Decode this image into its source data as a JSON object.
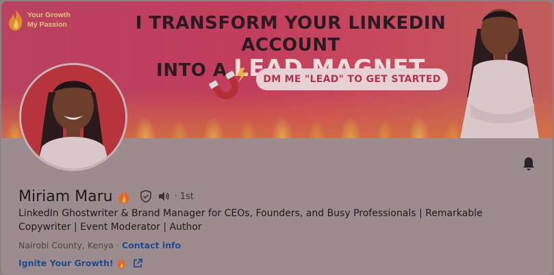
{
  "banner": {
    "brand_line1": "Your Growth",
    "brand_line2": "My Passion",
    "headline_line1": "I TRANSFORM YOUR LINKEDIN ACCOUNT",
    "headline_line2_prefix": "INTO A ",
    "headline_line2_accent": "LEAD MAGNET",
    "cta": "DM ME \"LEAD\" TO GET STARTED"
  },
  "profile": {
    "name": "Miriam Maru",
    "degree": "· 1st",
    "headline": "LinkedIn Ghostwriter & Brand Manager for CEOs, Founders, and Busy Professionals | Remarkable Copywriter | Event Moderator | Author",
    "location": "Nairobi County, Kenya",
    "separator": " · ",
    "contact_info": "Contact info",
    "website_label": "Ignite Your Growth!"
  },
  "colors": {
    "link": "#1f4a8c",
    "banner_accent": "#b2334f"
  },
  "icons": {
    "verified": "shield-check-icon",
    "pronounce": "speaker-icon",
    "bell": "bell-icon",
    "external": "external-link-icon",
    "fire": "fire-emoji-icon"
  }
}
